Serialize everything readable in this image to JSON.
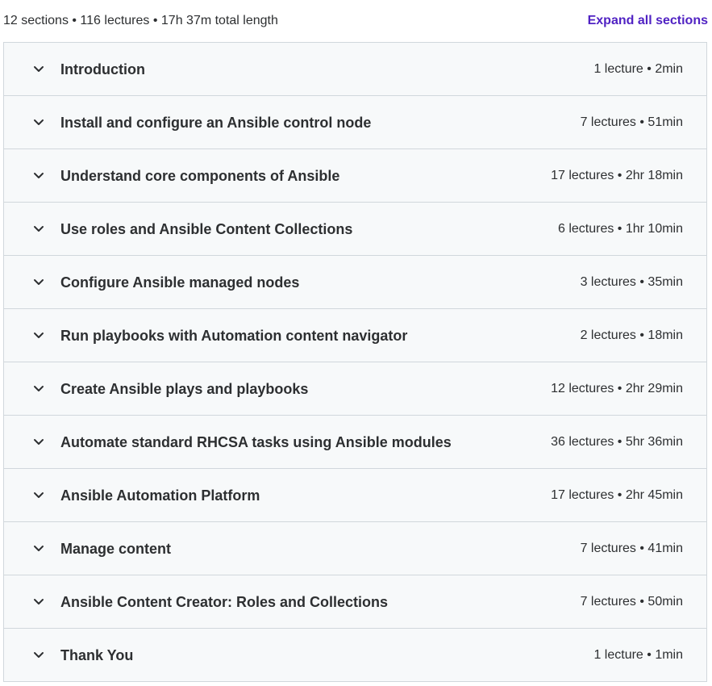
{
  "summary": {
    "text": "12 sections • 116 lectures • 17h 37m total length",
    "expand_label": "Expand all sections"
  },
  "colors": {
    "accent": "#5022c3",
    "section_bg": "#f7f9fa",
    "border": "#d1d7dc",
    "text": "#2d2f31"
  },
  "icons": {
    "section_toggle": "chevron-down-icon"
  },
  "sections": [
    {
      "title": "Introduction",
      "meta": "1 lecture • 2min"
    },
    {
      "title": "Install and configure an Ansible control node",
      "meta": "7 lectures • 51min"
    },
    {
      "title": "Understand core components of Ansible",
      "meta": "17 lectures • 2hr 18min"
    },
    {
      "title": "Use roles and Ansible Content Collections",
      "meta": "6 lectures • 1hr 10min"
    },
    {
      "title": "Configure Ansible managed nodes",
      "meta": "3 lectures • 35min"
    },
    {
      "title": "Run playbooks with Automation content navigator",
      "meta": "2 lectures • 18min"
    },
    {
      "title": "Create Ansible plays and playbooks",
      "meta": "12 lectures • 2hr 29min"
    },
    {
      "title": "Automate standard RHCSA tasks using Ansible modules",
      "meta": "36 lectures • 5hr 36min"
    },
    {
      "title": "Ansible Automation Platform",
      "meta": "17 lectures • 2hr 45min"
    },
    {
      "title": "Manage content",
      "meta": "7 lectures • 41min"
    },
    {
      "title": "Ansible Content Creator: Roles and Collections",
      "meta": "7 lectures • 50min"
    },
    {
      "title": "Thank You",
      "meta": "1 lecture • 1min"
    }
  ]
}
